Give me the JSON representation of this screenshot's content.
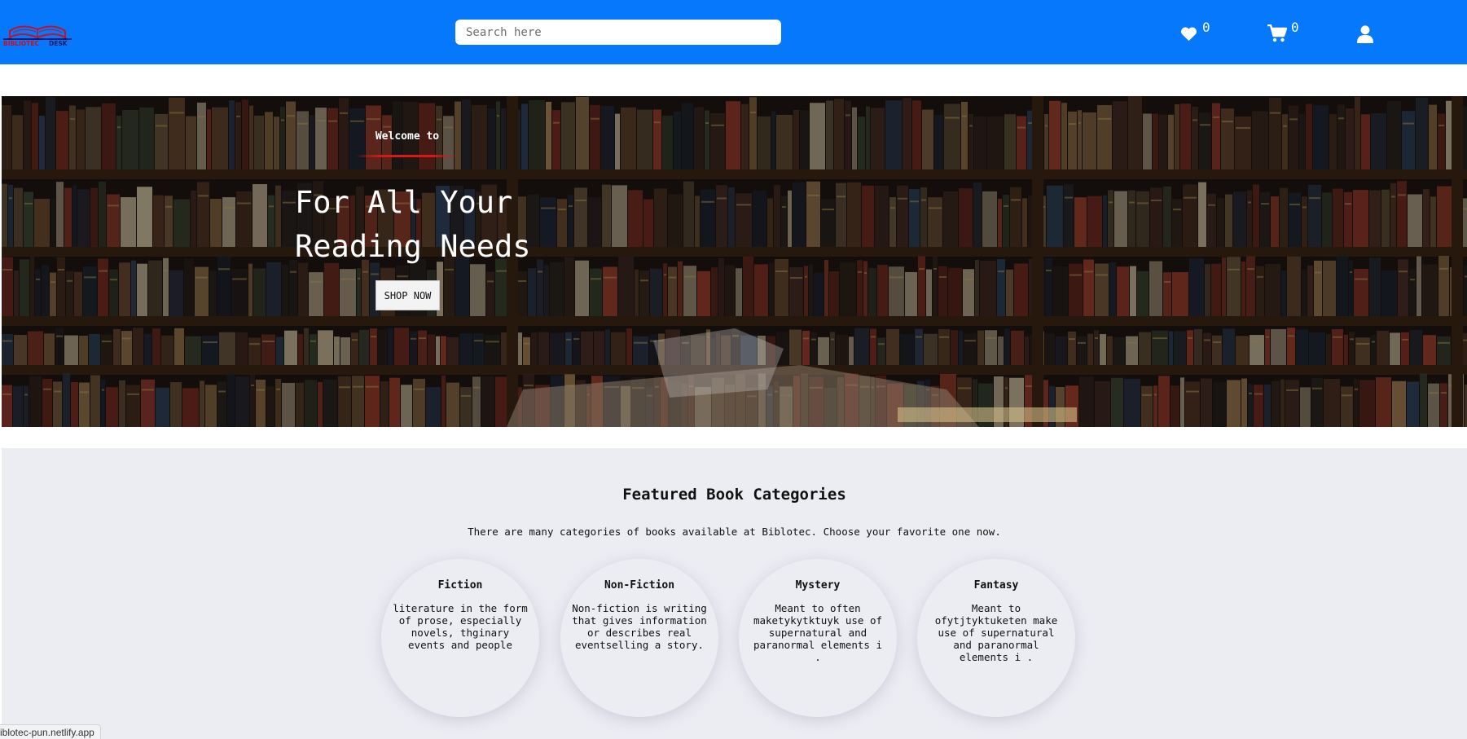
{
  "navbar": {
    "logo_text": "BIBLIOTEC DESK",
    "search_placeholder": "Search here",
    "wishlist_count": "0",
    "cart_count": "0",
    "bar_color": "#0578fc",
    "icons": [
      "heart-icon",
      "cart-icon",
      "user-icon"
    ]
  },
  "hero": {
    "welcome": "Welcome to",
    "title_line1": "For All Your",
    "title_line2": "Reading Needs",
    "shop_button": "SHOP NOW"
  },
  "categories": {
    "heading": "Featured Book Categories",
    "subheading": "There are many categories of books available at Biblotec. Choose your favorite one now.",
    "items": [
      {
        "title": "Fiction",
        "description": "literature in the form of prose, especially novels, thginary events and people"
      },
      {
        "title": "Non-Fiction",
        "description": "Non-fiction is writing that gives information or describes real eventselling a story."
      },
      {
        "title": "Mystery",
        "description": "Meant to often maketykytktuyk use of supernatural and paranormal elements i ."
      },
      {
        "title": "Fantasy",
        "description": "Meant to ofytjtyktuketen make use of supernatural and paranormal elements i ."
      }
    ]
  },
  "status_bar": {
    "url": "iblotec-pun.netlify.app"
  }
}
